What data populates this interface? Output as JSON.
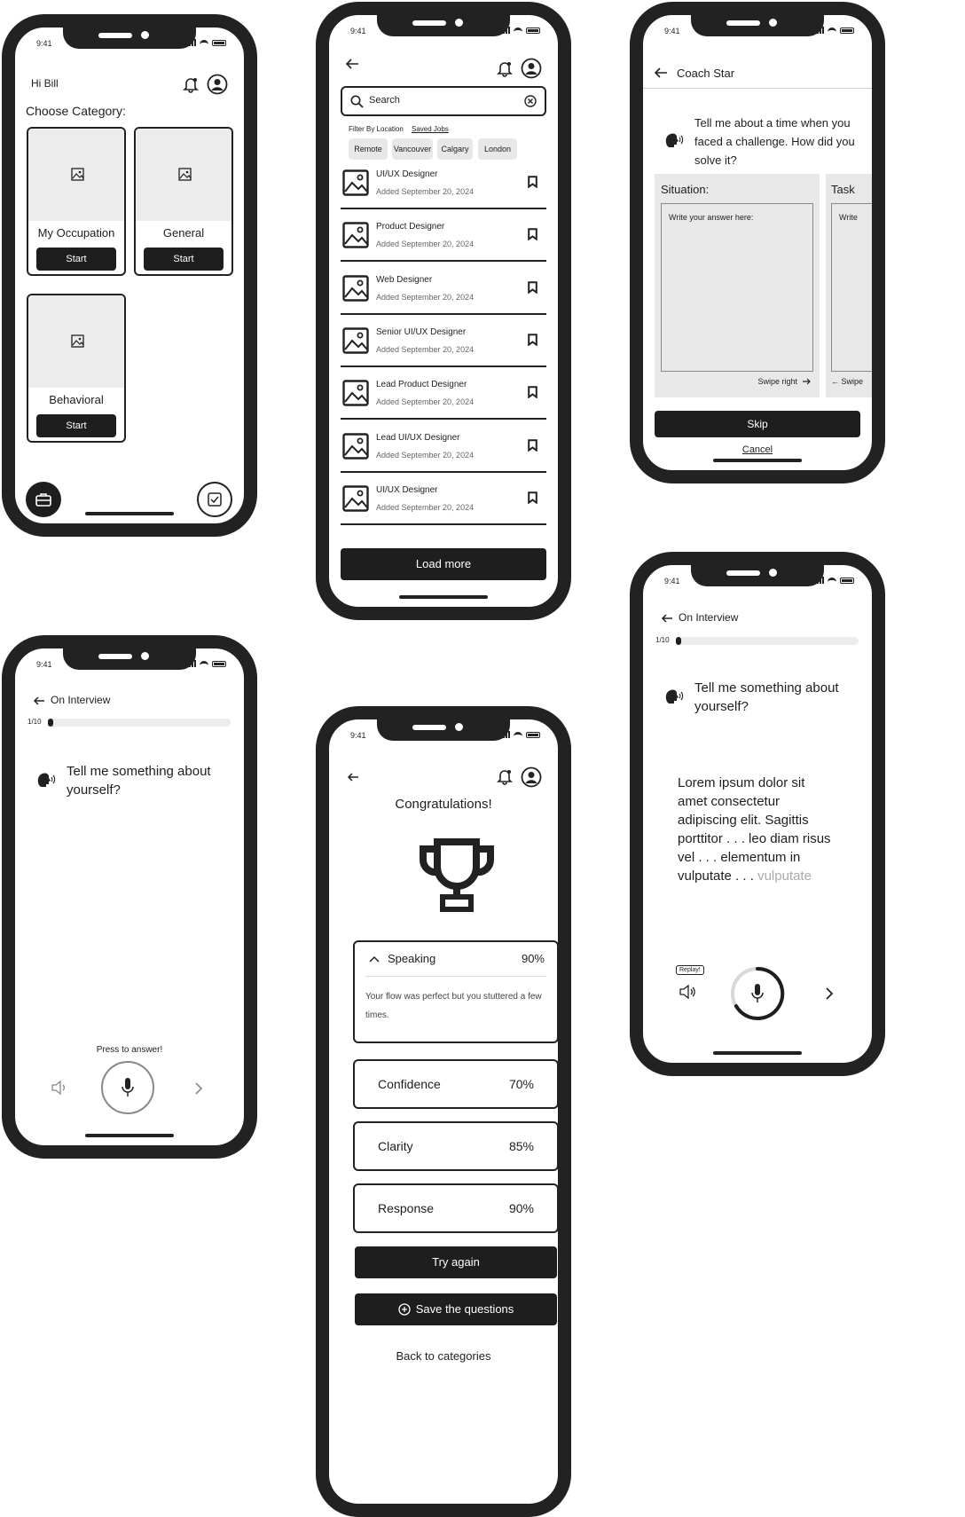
{
  "status": {
    "time": "9:41"
  },
  "home": {
    "greeting": "Hi Bill",
    "title": "Choose Category:",
    "categories": [
      {
        "label": "My Occupation",
        "button": "Start"
      },
      {
        "label": "General",
        "button": "Start"
      },
      {
        "label": "Behavioral",
        "button": "Start"
      }
    ]
  },
  "jobs": {
    "search_placeholder": "Search",
    "filter_label": "Filter By Location",
    "saved_jobs": "Saved Jobs",
    "chips": [
      "Remote",
      "Vancouver",
      "Calgary",
      "London"
    ],
    "items": [
      {
        "title": "UI/UX Designer",
        "date": "Added September 20, 2024"
      },
      {
        "title": "Product Designer",
        "date": "Added September 20, 2024"
      },
      {
        "title": "Web Designer",
        "date": "Added September 20, 2024"
      },
      {
        "title": "Senior UI/UX Designer",
        "date": "Added September 20, 2024"
      },
      {
        "title": "Lead Product Designer",
        "date": "Added September 20, 2024"
      },
      {
        "title": "Lead UI/UX Designer",
        "date": "Added September 20, 2024"
      },
      {
        "title": "UI/UX Designer",
        "date": "Added September 20, 2024"
      }
    ],
    "load_more": "Load more"
  },
  "coach": {
    "header": "Coach Star",
    "question": "Tell me about a time when you faced a challenge. How did you solve it?",
    "card1_title": "Situation:",
    "card1_placeholder": "Write your answer here:",
    "card1_swipe": "Swipe right",
    "card2_title": "Task",
    "card2_placeholder": "Write",
    "card2_swipe": "Swipe",
    "skip": "Skip",
    "cancel": "Cancel"
  },
  "interview1": {
    "header": "On Interview",
    "counter": "1/10",
    "progress": 0.02,
    "question": "Tell me something about yourself?",
    "press": "Press to answer!"
  },
  "results": {
    "title": "Congratulations!",
    "speaking": {
      "name": "Speaking",
      "pct": "90%",
      "feedback": "Your flow was perfect but you stuttered a few times."
    },
    "scores": [
      {
        "name": "Confidence",
        "pct": "70%"
      },
      {
        "name": "Clarity",
        "pct": "85%"
      },
      {
        "name": "Response",
        "pct": "90%"
      }
    ],
    "try_again": "Try again",
    "save": "Save the questions",
    "back": "Back to categories"
  },
  "interview2": {
    "header": "On Interview",
    "counter": "1/10",
    "progress": 0.02,
    "question": "Tell me something about yourself?",
    "answer": "Lorem ipsum dolor sit amet consectetur adipiscing elit. Sagittis porttitor . . . leo diam risus vel . . . elementum in vulputate . . .",
    "answer_faded": "vulputate",
    "replay": "Replay!"
  }
}
